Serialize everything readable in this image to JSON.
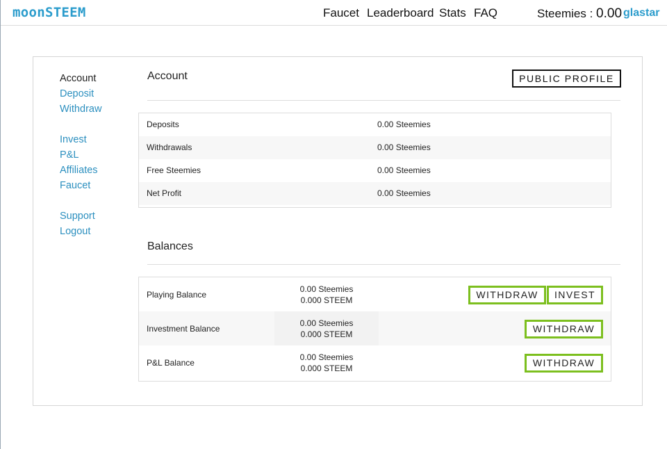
{
  "header": {
    "logo": "moonSTEEM",
    "nav": {
      "faucet": "Faucet",
      "leaderboard": "Leaderboard",
      "stats": "Stats",
      "faq": "FAQ"
    },
    "balance_label": "Steemies : ",
    "balance_value": "0.00",
    "username": "glastar"
  },
  "sidebar": {
    "account": "Account",
    "deposit": "Deposit",
    "withdraw": "Withdraw",
    "invest": "Invest",
    "pnl": "P&L",
    "affiliates": "Affiliates",
    "faucet": "Faucet",
    "support": "Support",
    "logout": "Logout"
  },
  "account_section": {
    "title": "Account",
    "public_profile_button": "PUBLIC PROFILE",
    "rows": [
      {
        "label": "Deposits",
        "value": "0.00 Steemies"
      },
      {
        "label": "Withdrawals",
        "value": "0.00 Steemies"
      },
      {
        "label": "Free Steemies",
        "value": "0.00 Steemies"
      },
      {
        "label": "Net Profit",
        "value": "0.00 Steemies"
      }
    ]
  },
  "balances_section": {
    "title": "Balances",
    "rows": [
      {
        "label": "Playing Balance",
        "steemies": "0.00 Steemies",
        "steem": "0.000 STEEM",
        "withdraw": "WITHDRAW",
        "invest": "INVEST"
      },
      {
        "label": "Investment Balance",
        "steemies": "0.00 Steemies",
        "steem": "0.000 STEEM",
        "withdraw": "WITHDRAW"
      },
      {
        "label": "P&L Balance",
        "steemies": "0.00 Steemies",
        "steem": "0.000 STEEM",
        "withdraw": "WITHDRAW"
      }
    ]
  },
  "colors": {
    "brand": "#2b9ccc",
    "button_green": "#7cbf1e",
    "link": "#2b8fbf"
  }
}
